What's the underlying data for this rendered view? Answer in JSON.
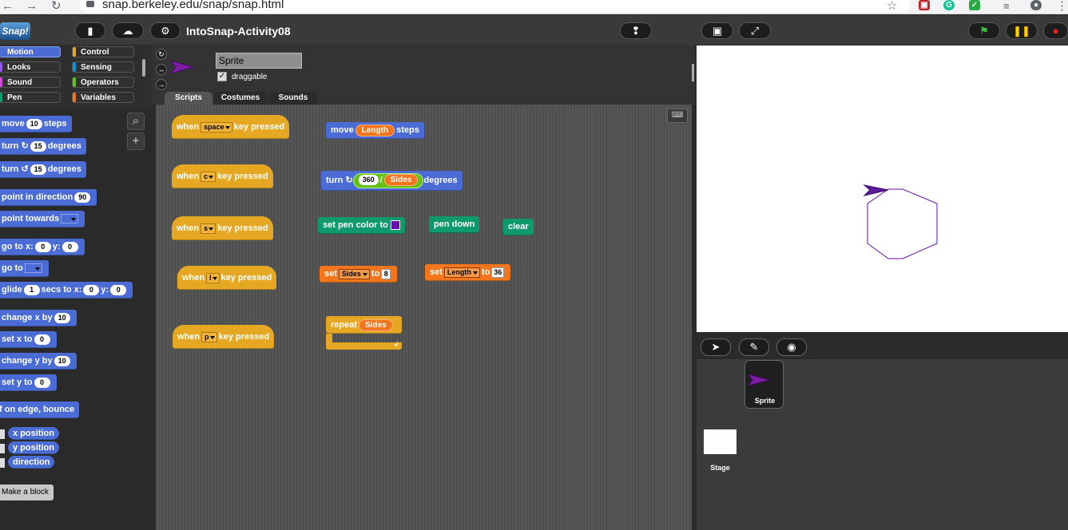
{
  "browser": {
    "url": "snap.berkeley.edu/snap/snap.html",
    "back_icon": "arrow-left-icon",
    "forward_icon": "arrow-right-icon",
    "reload_icon": "reload-icon",
    "lock_icon": "lock-icon",
    "star_icon": "star-icon"
  },
  "snap": {
    "logo": "Snap!",
    "project_title": "IntoSnap-Activity08",
    "accent": "#4a6cd4"
  },
  "categories": [
    {
      "label": "Motion",
      "color": "#4a6cd4"
    },
    {
      "label": "Control",
      "color": "#e6a822"
    },
    {
      "label": "Looks",
      "color": "#8f56e3"
    },
    {
      "label": "Sensing",
      "color": "#0494dc"
    },
    {
      "label": "Sound",
      "color": "#cf4ad9"
    },
    {
      "label": "Operators",
      "color": "#62c213"
    },
    {
      "label": "Pen",
      "color": "#0e9a6c"
    },
    {
      "label": "Variables",
      "color": "#f3761d"
    }
  ],
  "palette": {
    "move": {
      "a": "move",
      "v": "10",
      "b": "steps"
    },
    "turn_cw": {
      "a": "turn",
      "v": "15",
      "b": "degrees"
    },
    "turn_ccw": {
      "a": "turn",
      "v": "15",
      "b": "degrees"
    },
    "point_dir": {
      "a": "point in direction",
      "v": "90"
    },
    "point_towards": {
      "a": "point towards"
    },
    "goto_xy": {
      "a": "go to x:",
      "x": "0",
      "m": "y:",
      "y": "0"
    },
    "goto": {
      "a": "go to"
    },
    "glide": {
      "a": "glide",
      "s": "1",
      "m": "secs to x:",
      "x": "0",
      "m2": "y:",
      "y": "0"
    },
    "change_x": {
      "a": "change x by",
      "v": "10"
    },
    "set_x": {
      "a": "set x to",
      "v": "0"
    },
    "change_y": {
      "a": "change y by",
      "v": "10"
    },
    "set_y": {
      "a": "set y to",
      "v": "0"
    },
    "bounce": {
      "a": "if on edge, bounce"
    },
    "reporters": [
      "x position",
      "y position",
      "direction"
    ],
    "make_block": "Make a block"
  },
  "sprite": {
    "name": "Sprite",
    "draggable_label": "draggable",
    "draggable_checked": "✓",
    "tabs": [
      "Scripts",
      "Costumes",
      "Sounds"
    ]
  },
  "scripts": {
    "when_label": "when",
    "key_pressed_label": "key pressed",
    "hats": [
      "space",
      "c",
      "s",
      "l",
      "p"
    ],
    "move": {
      "a": "move",
      "var": "Length",
      "b": "steps"
    },
    "turn": {
      "a": "turn",
      "n": "360",
      "op": "/",
      "var": "Sides",
      "b": "degrees"
    },
    "set_pen_color": {
      "a": "set pen color to",
      "color": "#6a0dad"
    },
    "pen_down": "pen down",
    "clear": "clear",
    "set_sides": {
      "a": "set",
      "var": "Sides",
      "to": "to",
      "v": "8"
    },
    "set_length": {
      "a": "set",
      "var": "Length",
      "to": "to",
      "v": "36"
    },
    "repeat": {
      "a": "repeat",
      "var": "Sides"
    }
  },
  "corral": {
    "sprite_label": "Sprite",
    "stage_label": "Stage"
  }
}
